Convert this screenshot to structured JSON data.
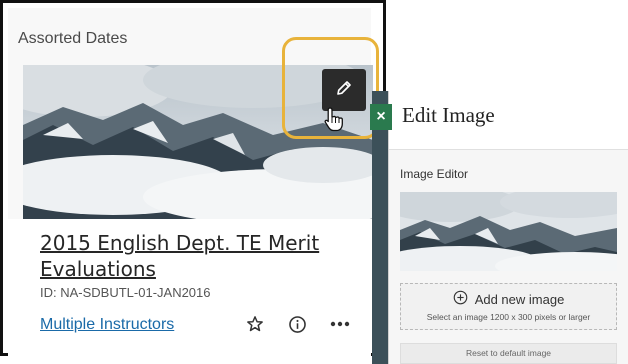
{
  "card": {
    "heading": "Assorted Dates",
    "course_title": "2015 English Dept. TE Merit Evaluations",
    "course_id": "ID: NA-SDBUTL-01-JAN2016",
    "instructors_link": "Multiple Instructors",
    "icons": [
      "pencil-icon",
      "star-icon",
      "info-icon",
      "more-icon"
    ]
  },
  "panel": {
    "close_label": "×",
    "title": "Edit Image",
    "editor_label": "Image Editor",
    "add_image_label": "Add new image",
    "add_image_hint": "Select an image 1200 x 300 pixels or larger",
    "reset_label": "Reset to default image"
  },
  "colors": {
    "highlight": "#e8b33b",
    "link": "#1a6aa8",
    "close_button": "#2a7a4e",
    "edit_button": "#2b2b2b"
  }
}
